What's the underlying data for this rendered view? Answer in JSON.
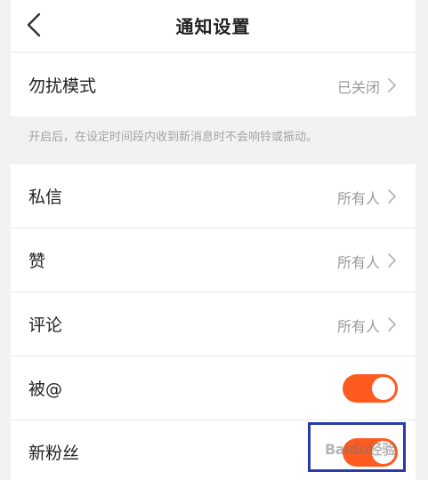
{
  "header": {
    "title": "通知设置"
  },
  "dnd": {
    "label": "勿扰模式",
    "value": "已关闭",
    "hint": "开启后，在设定时间段内收到新消息时不会响铃或振动。"
  },
  "rows": [
    {
      "label": "私信",
      "value": "所有人"
    },
    {
      "label": "赞",
      "value": "所有人"
    },
    {
      "label": "评论",
      "value": "所有人"
    },
    {
      "label": "被@",
      "toggle": true
    },
    {
      "label": "新粉丝",
      "toggle": true
    }
  ],
  "watermark": {
    "text": "Baidu经验"
  },
  "colors": {
    "accent": "#ff5a1f",
    "highlight_box": "#2a3aa8"
  }
}
